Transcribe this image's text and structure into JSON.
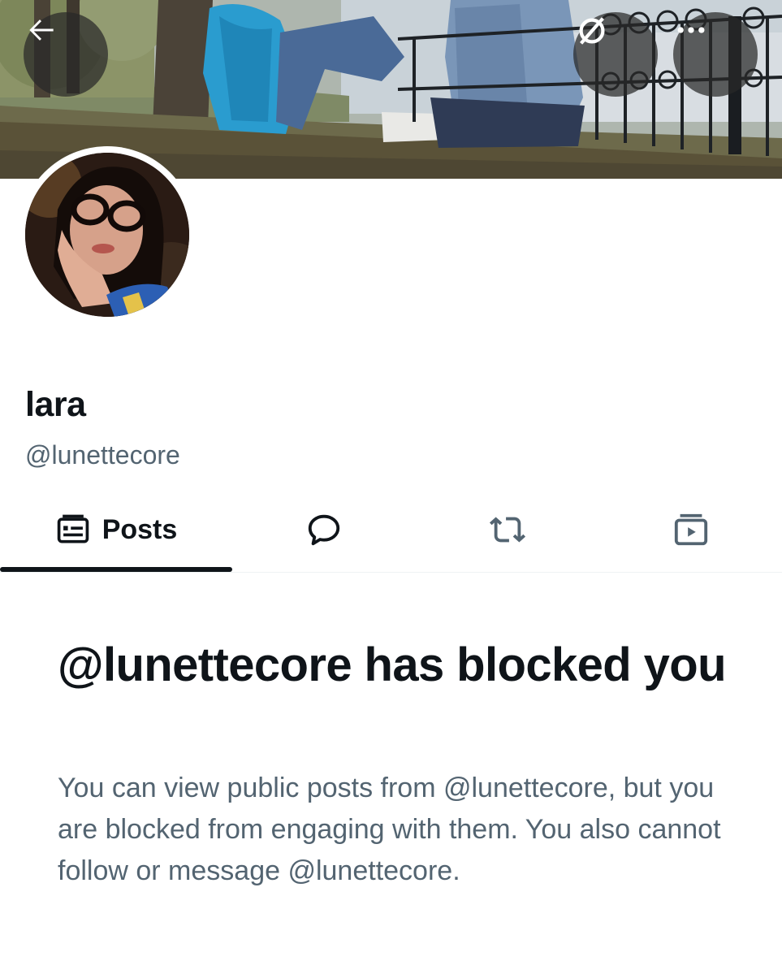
{
  "header": {
    "back_icon": "arrow-left-icon",
    "grok_icon": "grok-icon",
    "more_icon": "more-horizontal-icon"
  },
  "profile": {
    "display_name": "lara",
    "handle": "@lunettecore"
  },
  "tabs": [
    {
      "label": "Posts",
      "icon": "posts-icon",
      "selected": true
    },
    {
      "label": "",
      "icon": "reply-icon",
      "selected": false
    },
    {
      "label": "",
      "icon": "repost-icon",
      "selected": false
    },
    {
      "label": "",
      "icon": "media-icon",
      "selected": false
    }
  ],
  "blocked": {
    "title": "@lunettecore has blocked you",
    "body": "You can view public posts from @lunettecore, but you are blocked from engaging with them. You also cannot follow or message @lunettecore."
  },
  "colors": {
    "text_primary": "#0f1419",
    "text_secondary": "#536471",
    "divider": "#eff3f4"
  }
}
